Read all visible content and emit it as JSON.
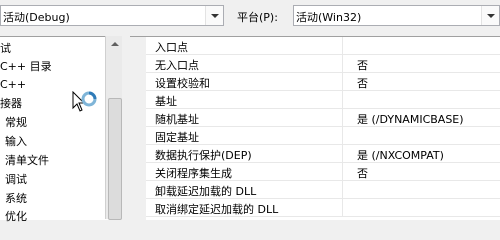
{
  "toolbar": {
    "configuration_value": "活动(Debug)",
    "platform_label": "平台(P):",
    "platform_value": "活动(Win32)"
  },
  "tree": {
    "items": [
      {
        "label": "试"
      },
      {
        "label": "C++ 目录"
      },
      {
        "label": "C++"
      },
      {
        "label": "接器"
      },
      {
        "label": "常规"
      },
      {
        "label": "输入"
      },
      {
        "label": "清单文件"
      },
      {
        "label": "调试"
      },
      {
        "label": "系统"
      },
      {
        "label": "优化"
      }
    ]
  },
  "properties": {
    "rows": [
      {
        "name": "入口点",
        "value": ""
      },
      {
        "name": "无入口点",
        "value": "否"
      },
      {
        "name": "设置校验和",
        "value": "否"
      },
      {
        "name": "基址",
        "value": ""
      },
      {
        "name": "随机基址",
        "value": "是 (/DYNAMICBASE)"
      },
      {
        "name": "固定基址",
        "value": ""
      },
      {
        "name": "数据执行保护(DEP)",
        "value": "是 (/NXCOMPAT)"
      },
      {
        "name": "关闭程序集生成",
        "value": "否"
      },
      {
        "name": "卸载延迟加载的 DLL",
        "value": ""
      },
      {
        "name": "取消绑定延迟加载的 DLL",
        "value": ""
      }
    ]
  }
}
